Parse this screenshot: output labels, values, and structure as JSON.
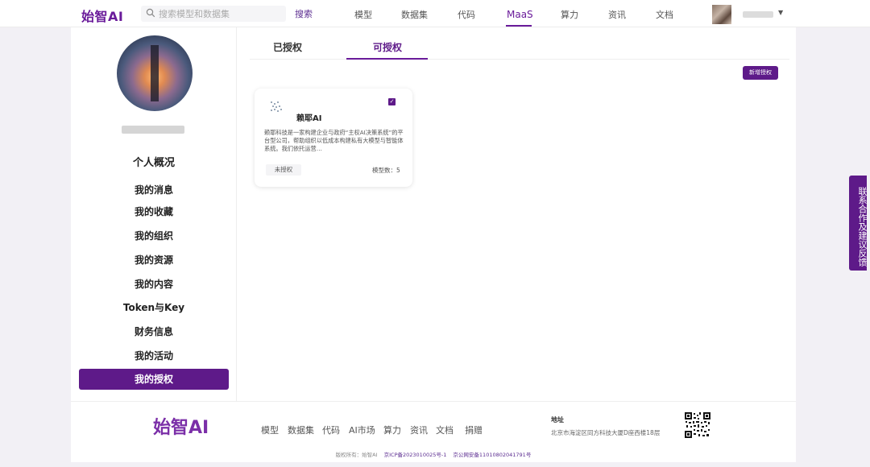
{
  "header": {
    "logo": "始智AI",
    "search_placeholder": "搜索模型和数据集",
    "search_button": "搜索",
    "nav": [
      "模型",
      "数据集",
      "代码",
      "MaaS",
      "算力",
      "资讯",
      "文档"
    ],
    "active_nav": "MaaS"
  },
  "sidebar": {
    "items": [
      "个人概况",
      "我的消息",
      "我的收藏",
      "我的组织",
      "我的资源",
      "我的内容",
      "Token与Key",
      "财务信息",
      "我的活动",
      "我的授权"
    ],
    "active": "我的授权"
  },
  "main": {
    "tabs": [
      "已授权",
      "可授权"
    ],
    "active_tab": "可授权",
    "add_button": "新增授权",
    "card": {
      "title": "赖耶AI",
      "description": "赖耶科技是一家构建企业与政府“主权AI决策系统”的平台型公司，帮助组织以低成本构建私有大模型与智能体系统。我们依托运营…",
      "status": "未授权",
      "model_count": "模型数：5",
      "checked": true
    }
  },
  "feedback": "联系合作及建议反馈",
  "footer": {
    "logo": "始智AI",
    "links": [
      "模型",
      "数据集",
      "代码",
      "AI市场",
      "算力",
      "资讯",
      "文档",
      "捐赠"
    ],
    "address_title": "地址",
    "address": "北京市海淀区同方科技大厦D座西楼18层",
    "copyright": "版权所有：始智AI",
    "icp": "京ICP备2023010025号-1",
    "police": "京公网安备11010802041791号"
  },
  "colors": {
    "accent": "#5e1a89",
    "background": "#f2f0f5"
  }
}
